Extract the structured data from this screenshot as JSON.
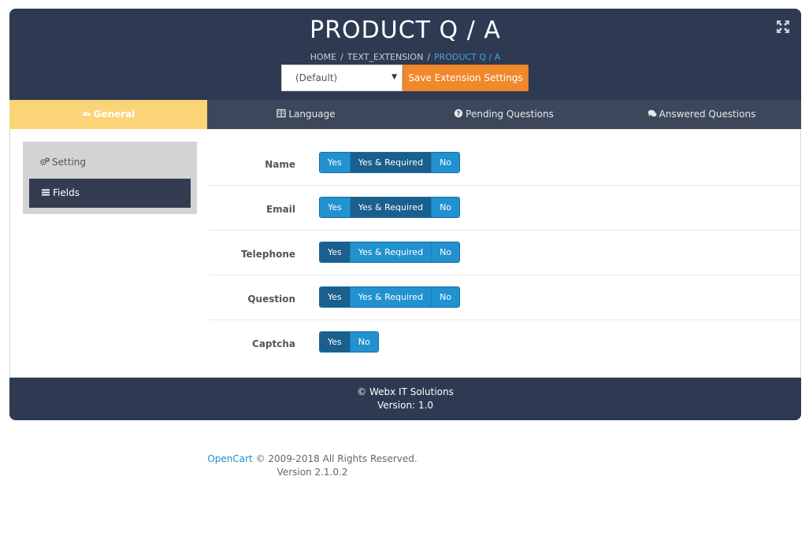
{
  "header": {
    "title": "PRODUCT Q / A",
    "breadcrumb": [
      {
        "label": "HOME"
      },
      {
        "label": "TEXT_EXTENSION"
      },
      {
        "label": "PRODUCT Q / A"
      }
    ],
    "separator": "/",
    "store_select": {
      "value": "(Default)"
    },
    "save_label": "Save Extension Settings"
  },
  "tabs": [
    {
      "label": "General",
      "icon": "dashboard-icon",
      "active": true
    },
    {
      "label": "Language",
      "icon": "language-book-icon",
      "active": false
    },
    {
      "label": "Pending Questions",
      "icon": "question-circle-icon",
      "active": false
    },
    {
      "label": "Answered Questions",
      "icon": "comments-icon",
      "active": false
    }
  ],
  "sidebar": {
    "items": [
      {
        "label": "Setting",
        "icon": "gears-icon",
        "active": false
      },
      {
        "label": "Fields",
        "icon": "bars-icon",
        "active": true
      }
    ]
  },
  "fields": [
    {
      "label": "Name",
      "options": [
        "Yes",
        "Yes & Required",
        "No"
      ],
      "selected": "Yes & Required"
    },
    {
      "label": "Email",
      "options": [
        "Yes",
        "Yes & Required",
        "No"
      ],
      "selected": "Yes & Required"
    },
    {
      "label": "Telephone",
      "options": [
        "Yes",
        "Yes & Required",
        "No"
      ],
      "selected": "Yes"
    },
    {
      "label": "Question",
      "options": [
        "Yes",
        "Yes & Required",
        "No"
      ],
      "selected": "Yes"
    },
    {
      "label": "Captcha",
      "options": [
        "Yes",
        "No"
      ],
      "selected": "Yes"
    }
  ],
  "footer": {
    "line1": "© Webx IT Solutions",
    "line2": "Version: 1.0"
  },
  "page_footer": {
    "link": "OpenCart",
    "copyright": " © 2009-2018 All Rights Reserved.",
    "version": "Version 2.1.0.2"
  },
  "colors": {
    "header_bg": "#2d3a52",
    "tab_active": "#fcd478",
    "save_button": "#f0882c",
    "toggle_blue": "#2191d0",
    "toggle_selected": "#1a5f8d",
    "breadcrumb_active": "#4aa3df"
  }
}
